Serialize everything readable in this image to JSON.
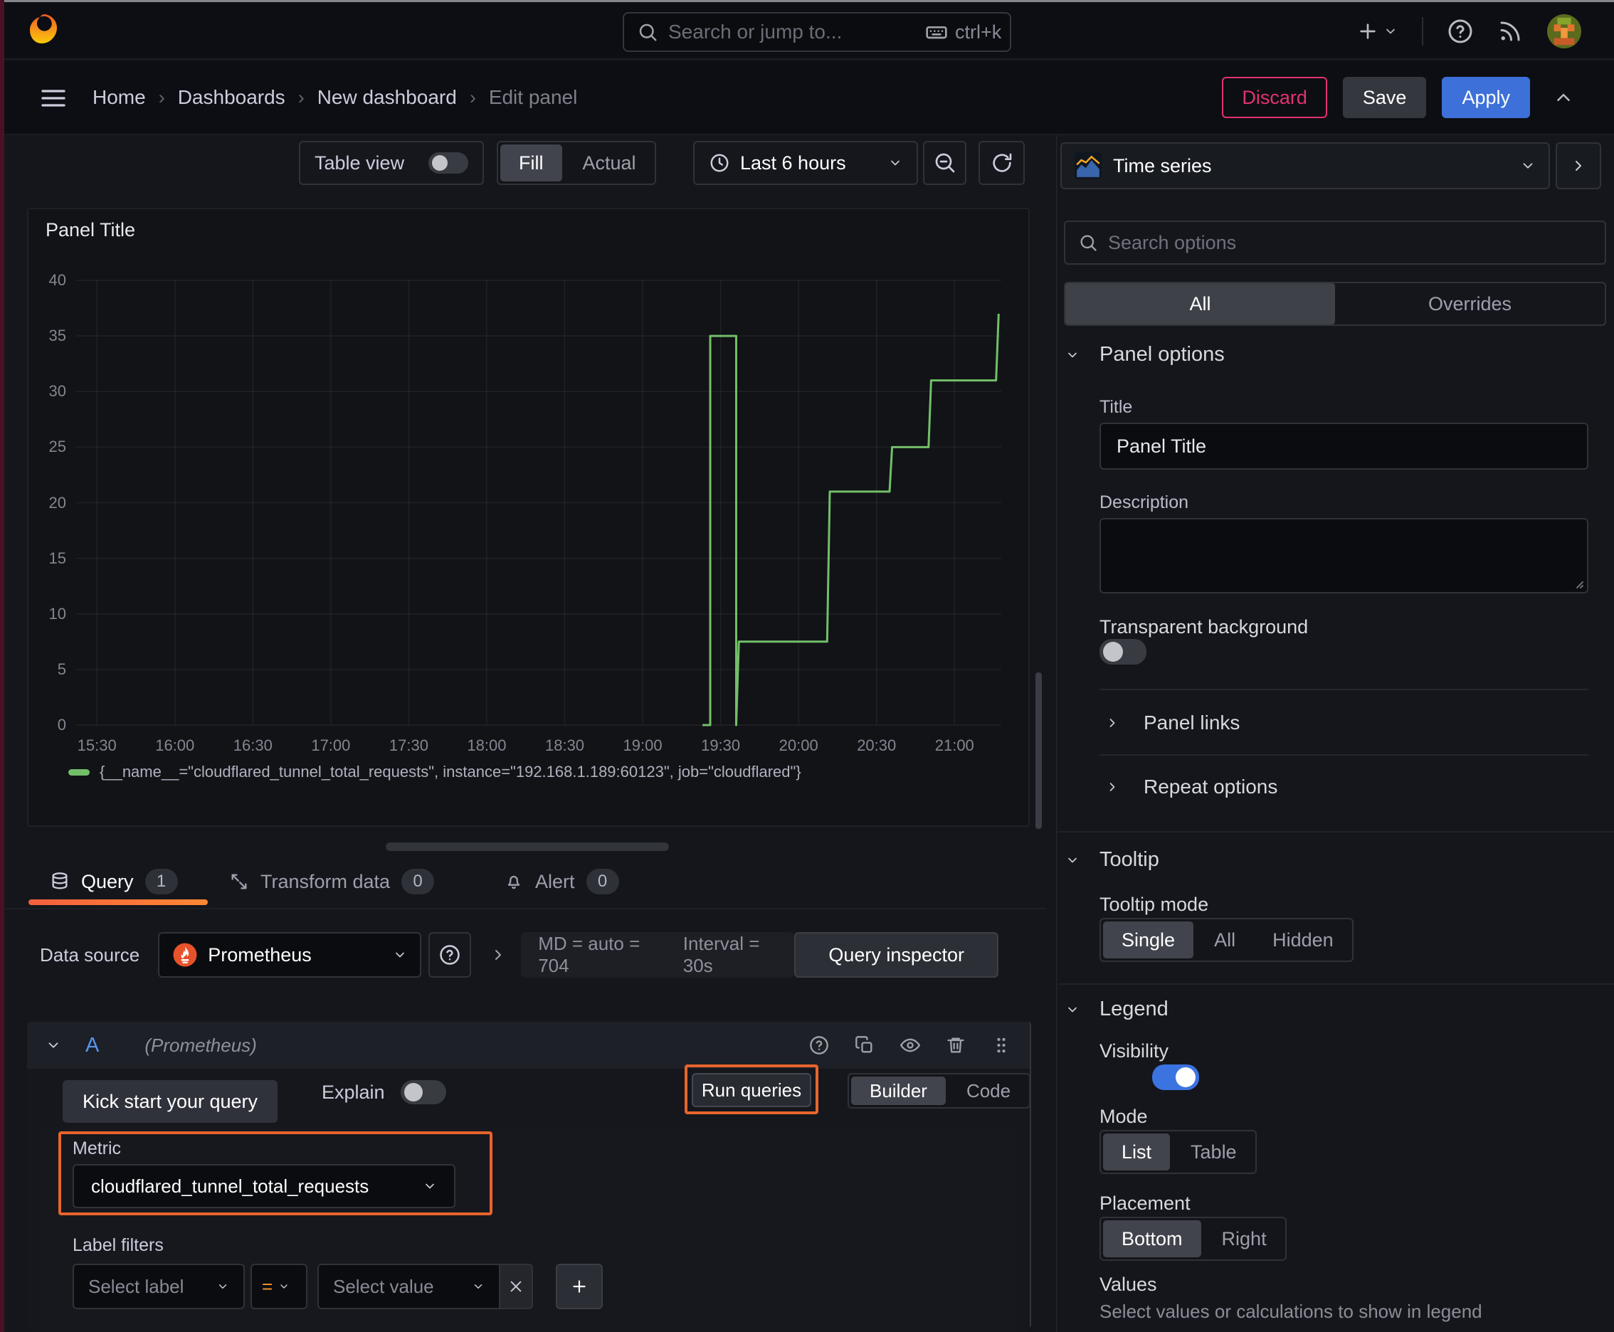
{
  "topnav": {
    "search_placeholder": "Search or jump to...",
    "shortcut": "ctrl+k"
  },
  "breadcrumb": {
    "items": [
      "Home",
      "Dashboards",
      "New dashboard",
      "Edit panel"
    ]
  },
  "actions": {
    "discard": "Discard",
    "save": "Save",
    "apply": "Apply"
  },
  "toolbar": {
    "table_view": "Table view",
    "fill": "Fill",
    "actual": "Actual",
    "time_range": "Last 6 hours"
  },
  "panel": {
    "title": "Panel Title"
  },
  "chart_data": {
    "type": "line",
    "title": "Panel Title",
    "x_domain_minutes": [
      922,
      1278
    ],
    "y_domain": [
      0,
      40
    ],
    "grid": true,
    "legend_position": "bottom",
    "x_ticks": [
      {
        "m": 930,
        "label": "15:30"
      },
      {
        "m": 960,
        "label": "16:00"
      },
      {
        "m": 990,
        "label": "16:30"
      },
      {
        "m": 1020,
        "label": "17:00"
      },
      {
        "m": 1050,
        "label": "17:30"
      },
      {
        "m": 1080,
        "label": "18:00"
      },
      {
        "m": 1110,
        "label": "18:30"
      },
      {
        "m": 1140,
        "label": "19:00"
      },
      {
        "m": 1170,
        "label": "19:30"
      },
      {
        "m": 1200,
        "label": "20:00"
      },
      {
        "m": 1230,
        "label": "20:30"
      },
      {
        "m": 1260,
        "label": "21:00"
      }
    ],
    "y_ticks": [
      0,
      5,
      10,
      15,
      20,
      25,
      30,
      35,
      40
    ],
    "series": [
      {
        "name": "{__name__=\"cloudflared_tunnel_total_requests\", instance=\"192.168.1.189:60123\", job=\"cloudflared\"}",
        "color": "#73BF69",
        "points": [
          [
            1163,
            0
          ],
          [
            1166,
            0
          ],
          [
            1166,
            35
          ],
          [
            1176,
            35
          ],
          [
            1176,
            0
          ],
          [
            1177,
            7.5
          ],
          [
            1211,
            7.5
          ],
          [
            1212,
            21
          ],
          [
            1235,
            21
          ],
          [
            1236,
            25
          ],
          [
            1250,
            25
          ],
          [
            1251,
            31
          ],
          [
            1276,
            31
          ],
          [
            1277,
            37
          ]
        ]
      }
    ]
  },
  "tabs": {
    "query": {
      "label": "Query",
      "count": "1"
    },
    "transform": {
      "label": "Transform data",
      "count": "0"
    },
    "alert": {
      "label": "Alert",
      "count": "0"
    }
  },
  "datasource": {
    "label": "Data source",
    "name": "Prometheus",
    "stat_md": "MD = auto = 704",
    "stat_interval": "Interval = 30s",
    "query_inspector": "Query inspector"
  },
  "query": {
    "ref_id": "A",
    "ds_hint": "(Prometheus)",
    "kick_start": "Kick start your query",
    "explain": "Explain",
    "run_queries": "Run queries",
    "builder": "Builder",
    "code": "Code",
    "metric_label": "Metric",
    "metric_value": "cloudflared_tunnel_total_requests",
    "label_filters": "Label filters",
    "select_label": "Select label",
    "operator": "=",
    "select_value": "Select value"
  },
  "sidebar": {
    "visualization": "Time series",
    "search_placeholder": "Search options",
    "tab_all": "All",
    "tab_overrides": "Overrides",
    "panel_options": {
      "heading": "Panel options",
      "title_label": "Title",
      "title_value": "Panel Title",
      "description_label": "Description",
      "transparent_label": "Transparent background",
      "panel_links": "Panel links",
      "repeat_options": "Repeat options"
    },
    "tooltip": {
      "heading": "Tooltip",
      "mode_label": "Tooltip mode",
      "options": [
        "Single",
        "All",
        "Hidden"
      ]
    },
    "legend": {
      "heading": "Legend",
      "visibility_label": "Visibility",
      "mode_label": "Mode",
      "mode_options": [
        "List",
        "Table"
      ],
      "placement_label": "Placement",
      "placement_options": [
        "Bottom",
        "Right"
      ],
      "values_label": "Values",
      "values_hint": "Select values or calculations to show in legend"
    }
  }
}
